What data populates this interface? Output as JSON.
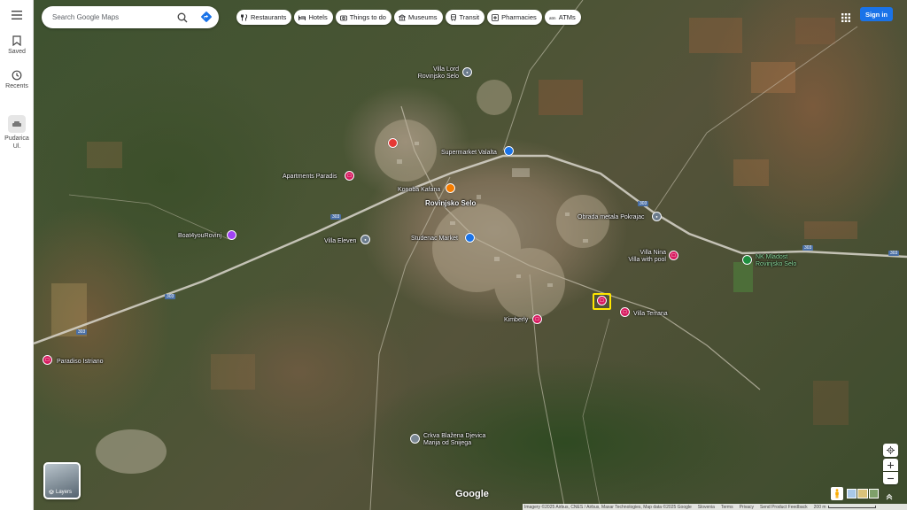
{
  "rail": {
    "saved": "Saved",
    "recents": "Recents",
    "place": "Pudarica Ul."
  },
  "search": {
    "placeholder": "Search Google Maps"
  },
  "chips": [
    {
      "label": "Restaurants",
      "icon": "fork-knife-icon"
    },
    {
      "label": "Hotels",
      "icon": "bed-icon"
    },
    {
      "label": "Things to do",
      "icon": "camera-icon"
    },
    {
      "label": "Museums",
      "icon": "museum-icon"
    },
    {
      "label": "Transit",
      "icon": "train-icon"
    },
    {
      "label": "Pharmacies",
      "icon": "pharmacy-icon"
    },
    {
      "label": "ATMs",
      "icon": "atm-icon"
    }
  ],
  "header": {
    "signin": "Sign in"
  },
  "map": {
    "places": {
      "villa_lord": "Villa Lord\nRovinjsko Selo",
      "supermarket": "Supermarket Valalta",
      "apartments_paradis": "Apartments Paradis",
      "konoba": "Konoba Kafana",
      "town": "Rovinjsko Selo",
      "obrada": "Obrada metala Pokrajac",
      "boat": "Boat4youRovinj",
      "villa_eleven": "Villa Eleven",
      "studenac": "Studenac Market",
      "villa_nina": "Villa Nina\nVilla with pool",
      "nk_mladost": "NK Mladost\nRovinjsko Selo",
      "kimberly": "Kimberly",
      "villa_terrana": "Villa Terrana",
      "paradiso": "Paradiso Istriano",
      "crkva": "Crkva Blažena Djevica\nMarija od Snijega"
    },
    "roads": {
      "r303": "303"
    }
  },
  "layers": {
    "label": "Layers"
  },
  "logo": "Google",
  "footer": {
    "imagery": "Imagery ©2025 Airbus, CNES / Airbus, Maxar Technologies, Map data ©2025 Google",
    "country": "Slovenia",
    "terms": "Terms",
    "privacy": "Privacy",
    "feedback": "Send Product Feedback",
    "scale": "200 m"
  },
  "colors": {
    "accent": "#1a73e8",
    "hotel": "#d81b60",
    "selection": "#ffe600"
  }
}
